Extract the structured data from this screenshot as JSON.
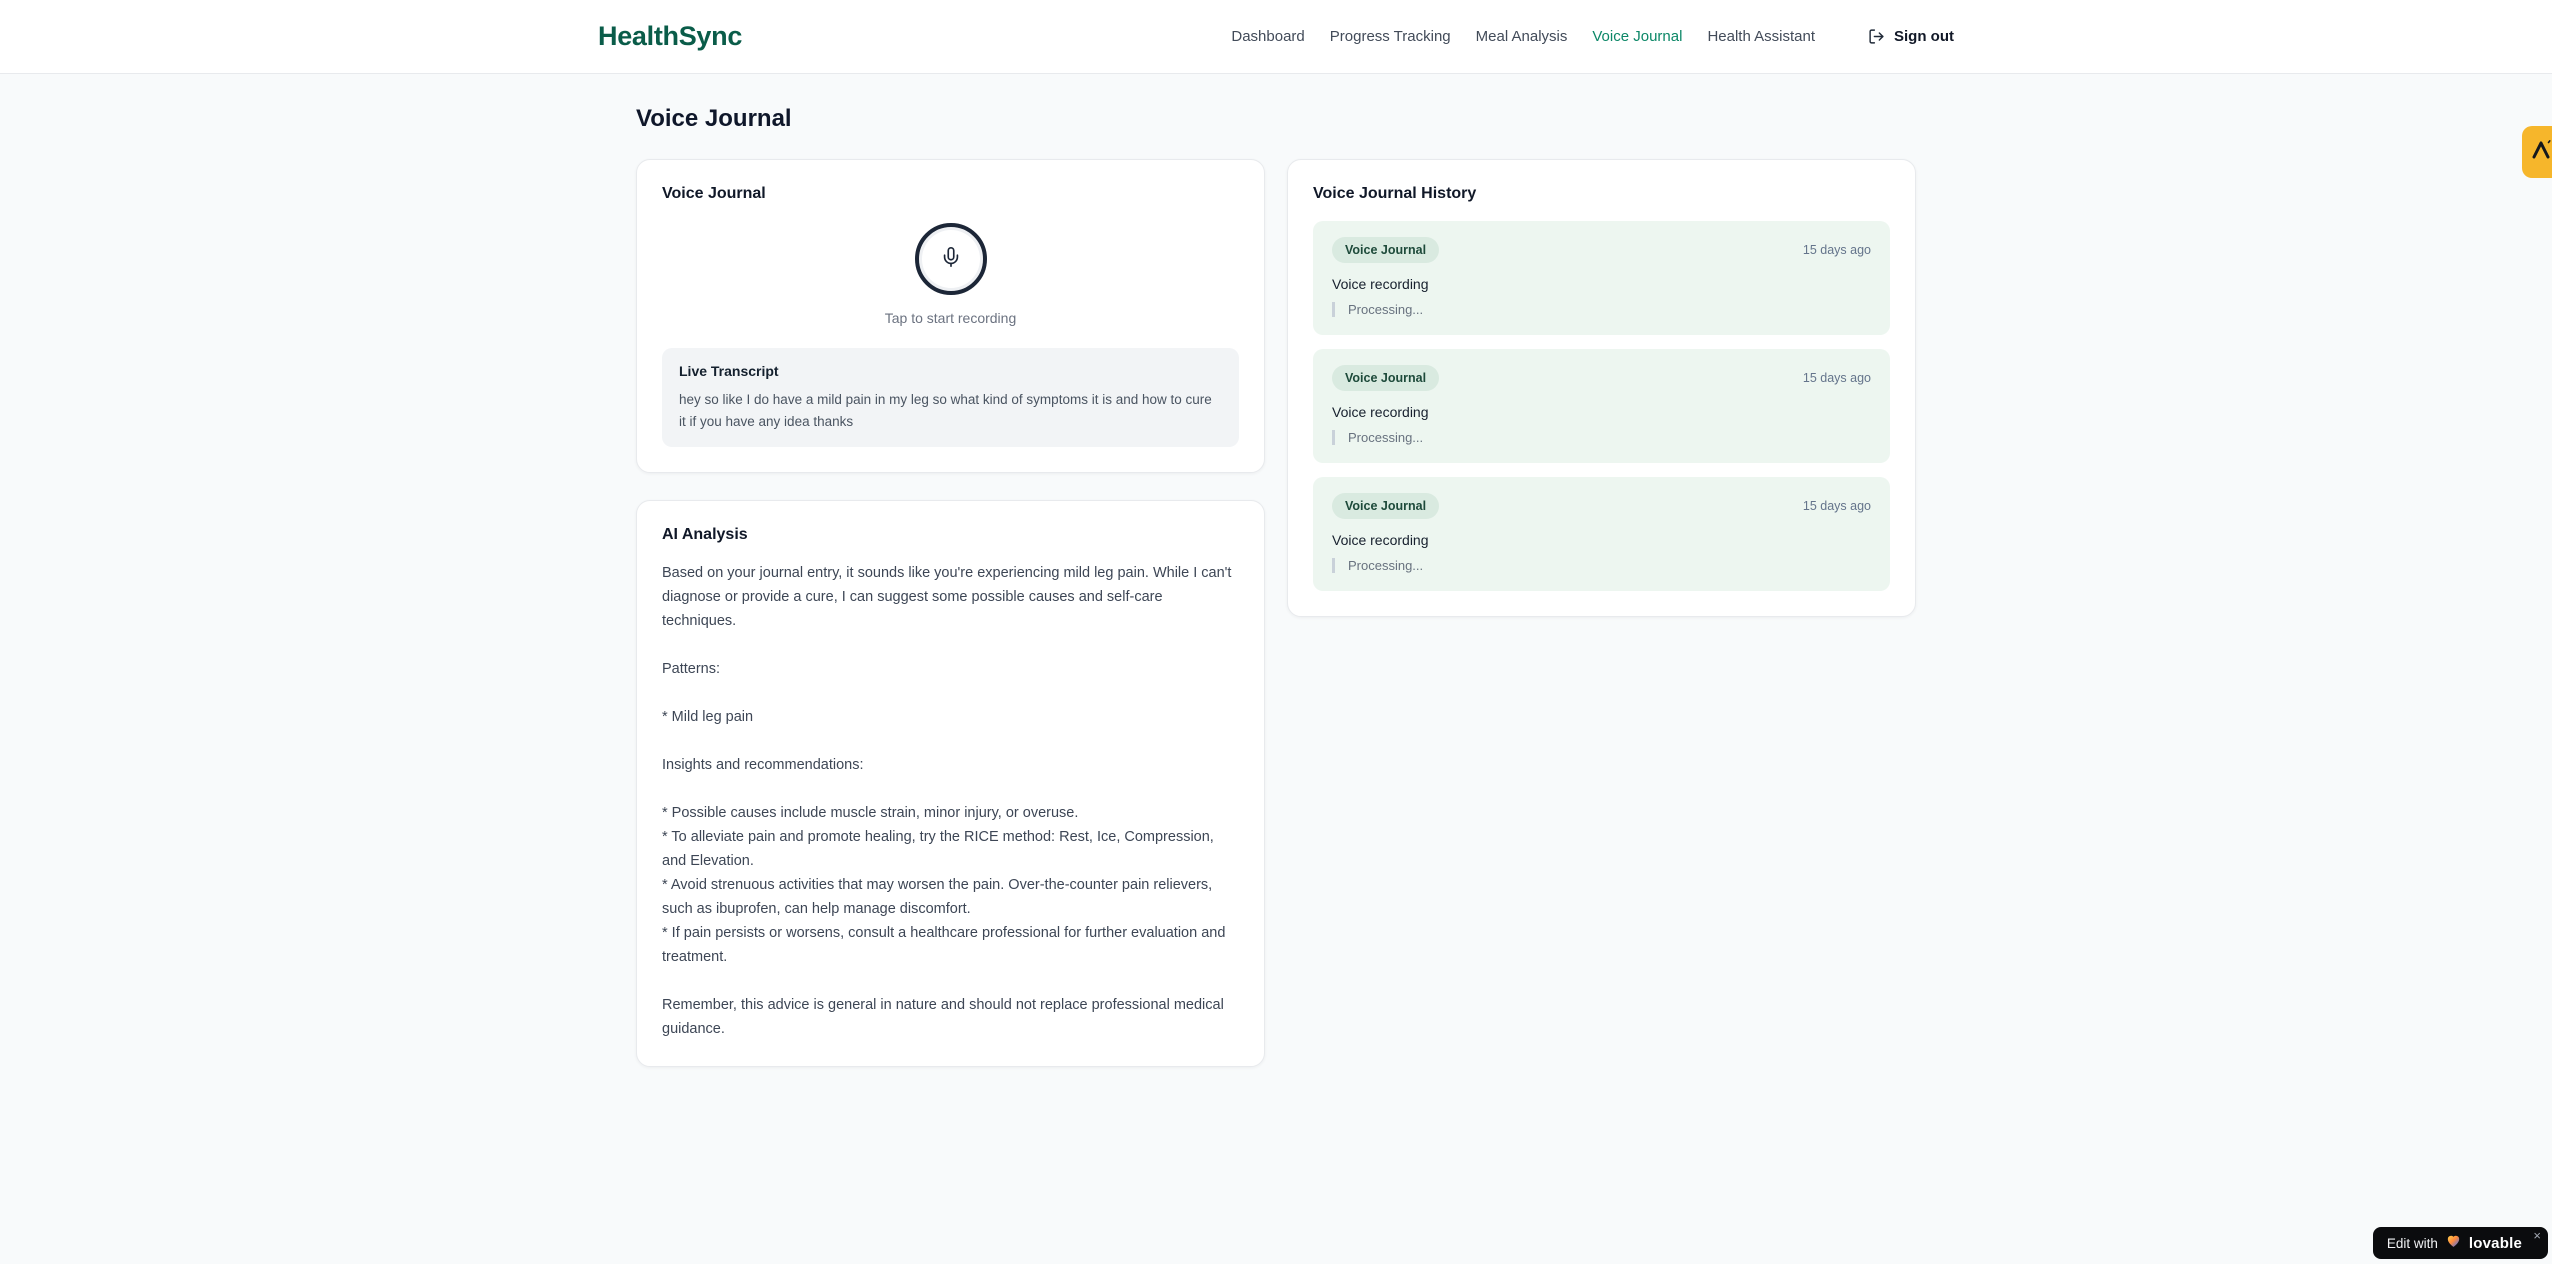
{
  "brand": {
    "name": "HealthSync"
  },
  "nav": {
    "items": [
      {
        "label": "Dashboard",
        "active": false
      },
      {
        "label": "Progress Tracking",
        "active": false
      },
      {
        "label": "Meal Analysis",
        "active": false
      },
      {
        "label": "Voice Journal",
        "active": true
      },
      {
        "label": "Health Assistant",
        "active": false
      }
    ],
    "sign_out_label": "Sign out"
  },
  "page": {
    "title": "Voice Journal"
  },
  "recorder_card": {
    "title": "Voice Journal",
    "tap_hint": "Tap to start recording",
    "live_transcript": {
      "title": "Live Transcript",
      "text": "hey so like I do have a mild pain in my leg so what kind of symptoms it is and how to cure it if you have any idea thanks"
    }
  },
  "analysis_card": {
    "title": "AI Analysis",
    "body": "Based on your journal entry, it sounds like you're experiencing mild leg pain. While I can't diagnose or provide a cure, I can suggest some possible causes and self-care techniques.\n\nPatterns:\n\n* Mild leg pain\n\nInsights and recommendations:\n\n* Possible causes include muscle strain, minor injury, or overuse.\n* To alleviate pain and promote healing, try the RICE method: Rest, Ice, Compression, and Elevation.\n* Avoid strenuous activities that may worsen the pain. Over-the-counter pain relievers, such as ibuprofen, can help manage discomfort.\n* If pain persists or worsens, consult a healthcare professional for further evaluation and treatment.\n\nRemember, this advice is general in nature and should not replace professional medical guidance."
  },
  "history_card": {
    "title": "Voice Journal History",
    "entries": [
      {
        "badge": "Voice Journal",
        "time": "15 days ago",
        "title": "Voice recording",
        "status": "Processing..."
      },
      {
        "badge": "Voice Journal",
        "time": "15 days ago",
        "title": "Voice recording",
        "status": "Processing..."
      },
      {
        "badge": "Voice Journal",
        "time": "15 days ago",
        "title": "Voice recording",
        "status": "Processing..."
      }
    ]
  },
  "overlays": {
    "edit_badge": {
      "prefix": "Edit with",
      "brand": "lovable",
      "close": "×",
      "icon": "heart-gradient-icon"
    },
    "side_badge": {
      "icon": "lambda-logo-icon"
    }
  },
  "colors": {
    "brand_teal": "#0a5c49",
    "active_nav": "#0c8767",
    "mic_ring": "#1c2637",
    "entry_bg": "#edf6f0",
    "badge_bg": "#d9eae0",
    "badge_text": "#1d4a3a",
    "amber_badge": "#f6b62b",
    "page_bg": "#f8fafb"
  }
}
